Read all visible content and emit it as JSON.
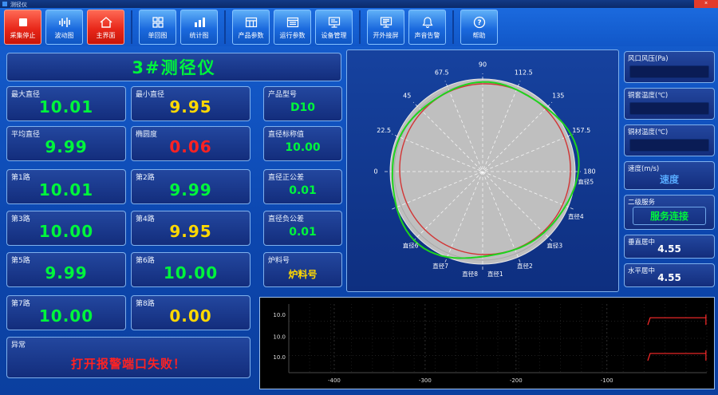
{
  "window": {
    "title": "测径仪",
    "close": "×"
  },
  "toolbar": {
    "buttons": [
      {
        "label": "采集停止"
      },
      {
        "label": "波动图"
      },
      {
        "label": "主界面"
      },
      {
        "label": "单回图"
      },
      {
        "label": "统计图"
      },
      {
        "label": "产品参数"
      },
      {
        "label": "运行参数"
      },
      {
        "label": "设备管理"
      },
      {
        "label": "开外接屏"
      },
      {
        "label": "声音告警"
      },
      {
        "label": "帮助"
      }
    ]
  },
  "panel_title": "3#测径仪",
  "fields": {
    "max_diameter": {
      "label": "最大直径",
      "value": "10.01",
      "color": "green"
    },
    "min_diameter": {
      "label": "最小直径",
      "value": "9.95",
      "color": "yellow"
    },
    "product_model": {
      "label": "产品型号",
      "value": "D10",
      "color": "green"
    },
    "avg_diameter": {
      "label": "平均直径",
      "value": "9.99",
      "color": "green"
    },
    "ovality": {
      "label": "椭圆度",
      "value": "0.06",
      "color": "red"
    },
    "nominal_diameter": {
      "label": "直径标称值",
      "value": "10.00",
      "color": "green"
    },
    "channel1": {
      "label": "第1路",
      "value": "10.01",
      "color": "green"
    },
    "channel2": {
      "label": "第2路",
      "value": "9.99",
      "color": "green"
    },
    "tolerance_plus": {
      "label": "直径正公差",
      "value": "0.01",
      "color": "green"
    },
    "channel3": {
      "label": "第3路",
      "value": "10.00",
      "color": "green"
    },
    "channel4": {
      "label": "第4路",
      "value": "9.95",
      "color": "yellow"
    },
    "tolerance_minus": {
      "label": "直径负公差",
      "value": "0.01",
      "color": "green"
    },
    "channel5": {
      "label": "第5路",
      "value": "9.99",
      "color": "green"
    },
    "channel6": {
      "label": "第6路",
      "value": "10.00",
      "color": "green"
    },
    "batch_number": {
      "label": "炉料号",
      "value": "炉料号",
      "color": "yellow"
    },
    "channel7": {
      "label": "第7路",
      "value": "10.00",
      "color": "green"
    },
    "channel8": {
      "label": "第8路",
      "value": "0.00",
      "color": "yellow"
    },
    "abnormal": {
      "label": "异常",
      "value": "打开报警端口失败！",
      "color": "red"
    }
  },
  "right_panel": {
    "wind_pressure": {
      "label": "风口风压(Pa)",
      "value": ""
    },
    "sleeve_temp": {
      "label": "铜套温度(℃)",
      "value": ""
    },
    "copper_temp": {
      "label": "铜材温度(℃)",
      "value": ""
    },
    "speed": {
      "label": "速度(m/s)",
      "value": "速度",
      "color": "blue"
    },
    "service": {
      "label": "二级服务",
      "value": "服务连接",
      "color": "green"
    },
    "vertical_center": {
      "label": "垂直居中",
      "value": "4.55",
      "color": "white"
    },
    "horizontal_center": {
      "label": "水平居中",
      "value": "4.55",
      "color": "white"
    }
  },
  "chart_data": [
    {
      "type": "polar",
      "title": "",
      "angle_tick_labels": [
        "0",
        "22.5",
        "45",
        "67.5",
        "90",
        "112.5",
        "135",
        "157.5",
        "180"
      ],
      "diameter_labels": [
        "直径1",
        "直径2",
        "直径3",
        "直径4",
        "直径5",
        "直径6",
        "直径7",
        "直径8"
      ],
      "channels": {
        "直径1": 10.01,
        "直径2": 9.99,
        "直径3": 10.0,
        "直径4": 9.95,
        "直径5": 9.99,
        "直径6": 10.0,
        "直径7": 10.0,
        "直径8": 0.0
      },
      "nominal": 10.0,
      "series": [
        {
          "name": "measured-profile",
          "color": "#1ed41e"
        },
        {
          "name": "reference-circle",
          "color": "#d23535"
        }
      ],
      "disk_color": "#bfbfbf"
    },
    {
      "type": "line",
      "x_axis_labels": [
        "-400",
        "-300",
        "-200",
        "-100"
      ],
      "x_range": [
        -450,
        10
      ],
      "y_axis_labels": [
        "10.0",
        "10.0",
        "10.0"
      ],
      "background": "#000000",
      "grid": true,
      "series": [
        {
          "name": "upper-diameter-trace",
          "color": "#ff2a2a",
          "value": 10.0,
          "x_start": -55,
          "x_end": 9,
          "level_frac": 0.2
        },
        {
          "name": "lower-diameter-trace",
          "color": "#ff2a2a",
          "value": 10.0,
          "x_start": -55,
          "x_end": 9,
          "level_frac": 0.72
        }
      ]
    }
  ]
}
